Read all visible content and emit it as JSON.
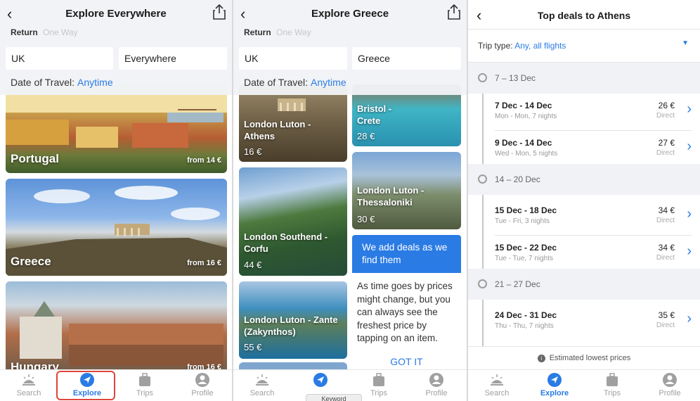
{
  "panel1": {
    "title": "Explore Everywhere",
    "trip_on": "Return",
    "trip_off": "One Way",
    "origin": "UK",
    "destination": "Everywhere",
    "date_label": "Date of Travel:",
    "date_value": "Anytime",
    "cards": [
      {
        "name": "Portugal",
        "price": "from 14 €"
      },
      {
        "name": "Greece",
        "price": "from 16 €"
      },
      {
        "name": "Hungary",
        "price": "from 16 €"
      }
    ]
  },
  "panel2": {
    "title": "Explore Greece",
    "trip_on": "Return",
    "trip_off": "One Way",
    "origin": "UK",
    "destination": "Greece",
    "date_label": "Date of Travel:",
    "date_value": "Anytime",
    "left_cards": [
      {
        "route": "London Luton - Athens",
        "price": "16 €"
      },
      {
        "route": "London Southend - Corfu",
        "price": "44 €"
      },
      {
        "route": "London Luton - Zante (Zakynthos)",
        "price": "55 €"
      }
    ],
    "right_cards": [
      {
        "route": "Bristol - Crete",
        "price": "28 €"
      },
      {
        "route": "London Luton - Thessaloniki",
        "price": "30 €"
      }
    ],
    "info": {
      "heading": "We add deals as we find them",
      "body": "As time goes by prices might change, but you can always see the freshest price by tapping on an item.",
      "action": "GOT IT"
    },
    "tooltip": "Keyword"
  },
  "panel3": {
    "title": "Top deals to Athens",
    "trip_type_label": "Trip type:",
    "trip_type_value": "Any, all flights",
    "weeks": [
      {
        "label": "7 – 13 Dec",
        "deals": [
          {
            "dates": "7 Dec - 14 Dec",
            "sub": "Mon - Mon, 7 nights",
            "price": "26 €",
            "kind": "Direct"
          },
          {
            "dates": "9 Dec - 14 Dec",
            "sub": "Wed - Mon, 5 nights",
            "price": "27 €",
            "kind": "Direct"
          }
        ]
      },
      {
        "label": "14 – 20 Dec",
        "deals": [
          {
            "dates": "15 Dec - 18 Dec",
            "sub": "Tue - Fri, 3 nights",
            "price": "34 €",
            "kind": "Direct"
          },
          {
            "dates": "15 Dec - 22 Dec",
            "sub": "Tue - Tue, 7 nights",
            "price": "34 €",
            "kind": "Direct"
          }
        ]
      },
      {
        "label": "21 – 27 Dec",
        "deals": [
          {
            "dates": "24 Dec - 31 Dec",
            "sub": "Thu - Thu, 7 nights",
            "price": "35 €",
            "kind": "Direct"
          }
        ]
      }
    ],
    "footer": "Estimated lowest prices"
  },
  "tabs": [
    "Search",
    "Explore",
    "Trips",
    "Profile"
  ],
  "colors": {
    "accent": "#2a7be4",
    "highlight": "#e0453c"
  }
}
